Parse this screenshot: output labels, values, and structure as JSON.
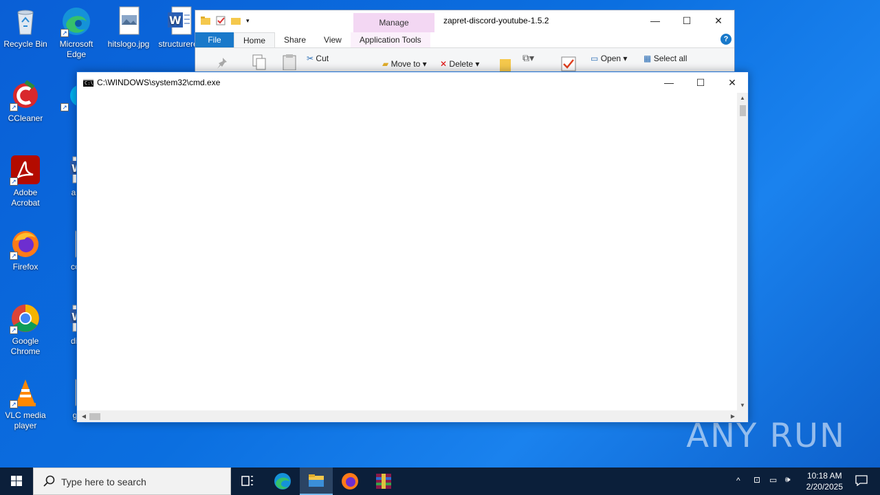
{
  "desktop": {
    "icons": [
      {
        "label": "Recycle Bin"
      },
      {
        "label": "Microsoft Edge"
      },
      {
        "label": "hitslogo.jpg"
      },
      {
        "label": "structurere"
      },
      {
        "label": "CCleaner"
      },
      {
        "label": "Sky"
      },
      {
        "label": "Adobe Acrobat"
      },
      {
        "label": "analys"
      },
      {
        "label": "Firefox"
      },
      {
        "label": "compu"
      },
      {
        "label": "Google Chrome"
      },
      {
        "label": "diepub"
      },
      {
        "label": "VLC media player"
      },
      {
        "label": "group"
      }
    ],
    "watermark": "ANY RUN"
  },
  "explorer": {
    "title": "zapret-discord-youtube-1.5.2",
    "manage_label": "Manage",
    "tabs": {
      "file": "File",
      "home": "Home",
      "share": "Share",
      "view": "View",
      "app_tools": "Application Tools"
    },
    "ribbon": {
      "cut": "Cut",
      "move_to": "Move to",
      "delete": "Delete",
      "open": "Open",
      "select_all": "Select all"
    },
    "help": "?"
  },
  "cmd": {
    "title": "C:\\WINDOWS\\system32\\cmd.exe"
  },
  "taskbar": {
    "search_placeholder": "Type here to search",
    "time": "10:18 AM",
    "date": "2/20/2025"
  },
  "colors": {
    "desktop": "#0b6fe0",
    "taskbar": "#0b1f3a",
    "accent": "#1979ca"
  }
}
